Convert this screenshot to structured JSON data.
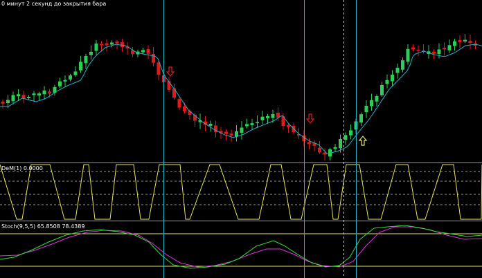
{
  "header": {
    "status_text": "0 минут 2 секунд до закрытия бара"
  },
  "indicators": {
    "dem_label": "DeM(1) 0.0000",
    "stoch_label": "Stoch(9,5,5) 65.8508 78.4389"
  },
  "colors": {
    "background": "#000000",
    "bull": "#2ecc59",
    "bear": "#e01a1a",
    "ma": "#20b2c8",
    "vline": "#20b2c8",
    "dem_line": "#e6e65a",
    "stoch_main": "#33dd33",
    "stoch_signal": "#dd33dd",
    "level": "#e6e65a",
    "arrow_down": "#e01a1a",
    "arrow_up": "#e6e65a"
  },
  "icons": {
    "sell_arrow": "down-arrow-icon",
    "buy_arrow": "up-arrow-icon"
  }
}
